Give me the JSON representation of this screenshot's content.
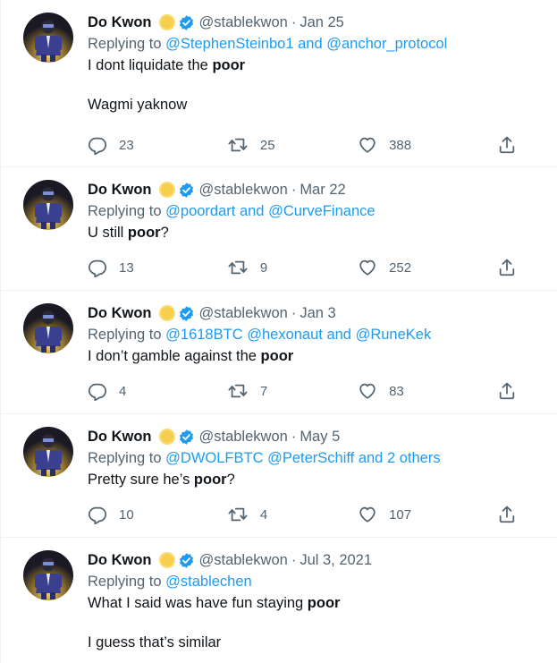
{
  "colors": {
    "mention": "#1d9bf0",
    "secondary_text": "#536471",
    "primary_text": "#0f1419",
    "verified_badge": "#1d9bf0",
    "sun_emoji": "#f7cf4d",
    "divider": "#eff3f4"
  },
  "tweets": [
    {
      "author": {
        "name": "Do Kwon",
        "handle": "@stablekwon",
        "badges": [
          "sun-emoji-icon",
          "verified-badge-icon"
        ]
      },
      "separator": "·",
      "date": "Jan 25",
      "replying_to_prefix": "Replying to",
      "replying_to": [
        "@StephenSteinbo1",
        " and ",
        "@anchor_protocol"
      ],
      "text_parts": [
        {
          "before": "I dont liquidate the ",
          "bold": "poor",
          "after": ""
        },
        {
          "before": "Wagmi yaknow",
          "bold": "",
          "after": ""
        }
      ],
      "stats": {
        "replies": "23",
        "retweets": "25",
        "likes": "388"
      }
    },
    {
      "author": {
        "name": "Do Kwon",
        "handle": "@stablekwon",
        "badges": [
          "sun-emoji-icon",
          "verified-badge-icon"
        ]
      },
      "separator": "·",
      "date": "Mar 22",
      "replying_to_prefix": "Replying to",
      "replying_to": [
        "@poordart",
        " and ",
        "@CurveFinance"
      ],
      "text_parts": [
        {
          "before": "U still ",
          "bold": "poor",
          "after": "?"
        }
      ],
      "stats": {
        "replies": "13",
        "retweets": "9",
        "likes": "252"
      }
    },
    {
      "author": {
        "name": "Do Kwon",
        "handle": "@stablekwon",
        "badges": [
          "sun-emoji-icon",
          "verified-badge-icon"
        ]
      },
      "separator": "·",
      "date": "Jan 3",
      "replying_to_prefix": "Replying to",
      "replying_to": [
        "@1618BTC",
        " ",
        "@hexonaut",
        " and ",
        "@RuneKek"
      ],
      "text_parts": [
        {
          "before": "I don’t gamble against the ",
          "bold": "poor",
          "after": ""
        }
      ],
      "stats": {
        "replies": "4",
        "retweets": "7",
        "likes": "83"
      }
    },
    {
      "author": {
        "name": "Do Kwon",
        "handle": "@stablekwon",
        "badges": [
          "sun-emoji-icon",
          "verified-badge-icon"
        ]
      },
      "separator": "·",
      "date": "May 5",
      "replying_to_prefix": "Replying to",
      "replying_to": [
        "@DWOLFBTC",
        " ",
        "@PeterSchiff",
        " and ",
        "2 others"
      ],
      "text_parts": [
        {
          "before": "Pretty sure he’s ",
          "bold": "poor",
          "after": "?"
        }
      ],
      "stats": {
        "replies": "10",
        "retweets": "4",
        "likes": "107"
      }
    },
    {
      "author": {
        "name": "Do Kwon",
        "handle": "@stablekwon",
        "badges": [
          "sun-emoji-icon",
          "verified-badge-icon"
        ]
      },
      "separator": "·",
      "date": "Jul 3, 2021",
      "replying_to_prefix": "Replying to",
      "replying_to": [
        "@stablechen"
      ],
      "text_parts": [
        {
          "before": "What I said was have fun staying ",
          "bold": "poor",
          "after": ""
        },
        {
          "before": "I guess that’s similar",
          "bold": "",
          "after": ""
        }
      ],
      "stats": null
    }
  ]
}
